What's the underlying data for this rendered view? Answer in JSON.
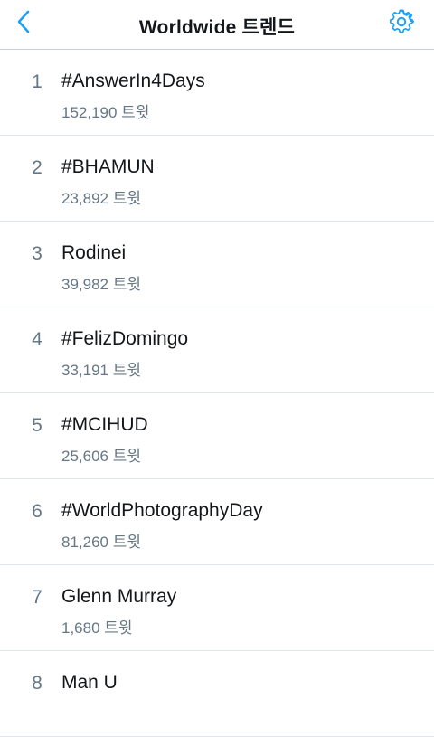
{
  "header": {
    "title": "Worldwide 트렌드",
    "back_icon": "chevron-left-icon",
    "settings_icon": "gear-icon",
    "accent_color": "#1da1f2"
  },
  "trends": [
    {
      "rank": "1",
      "name": "#AnswerIn4Days",
      "count": "152,190 트윗"
    },
    {
      "rank": "2",
      "name": "#BHAMUN",
      "count": "23,892 트윗"
    },
    {
      "rank": "3",
      "name": "Rodinei",
      "count": "39,982 트윗"
    },
    {
      "rank": "4",
      "name": "#FelizDomingo",
      "count": "33,191 트윗"
    },
    {
      "rank": "5",
      "name": "#MCIHUD",
      "count": "25,606 트윗"
    },
    {
      "rank": "6",
      "name": "#WorldPhotographyDay",
      "count": "81,260 트윗"
    },
    {
      "rank": "7",
      "name": "Glenn Murray",
      "count": "1,680 트윗"
    },
    {
      "rank": "8",
      "name": "Man U",
      "count": ""
    }
  ]
}
